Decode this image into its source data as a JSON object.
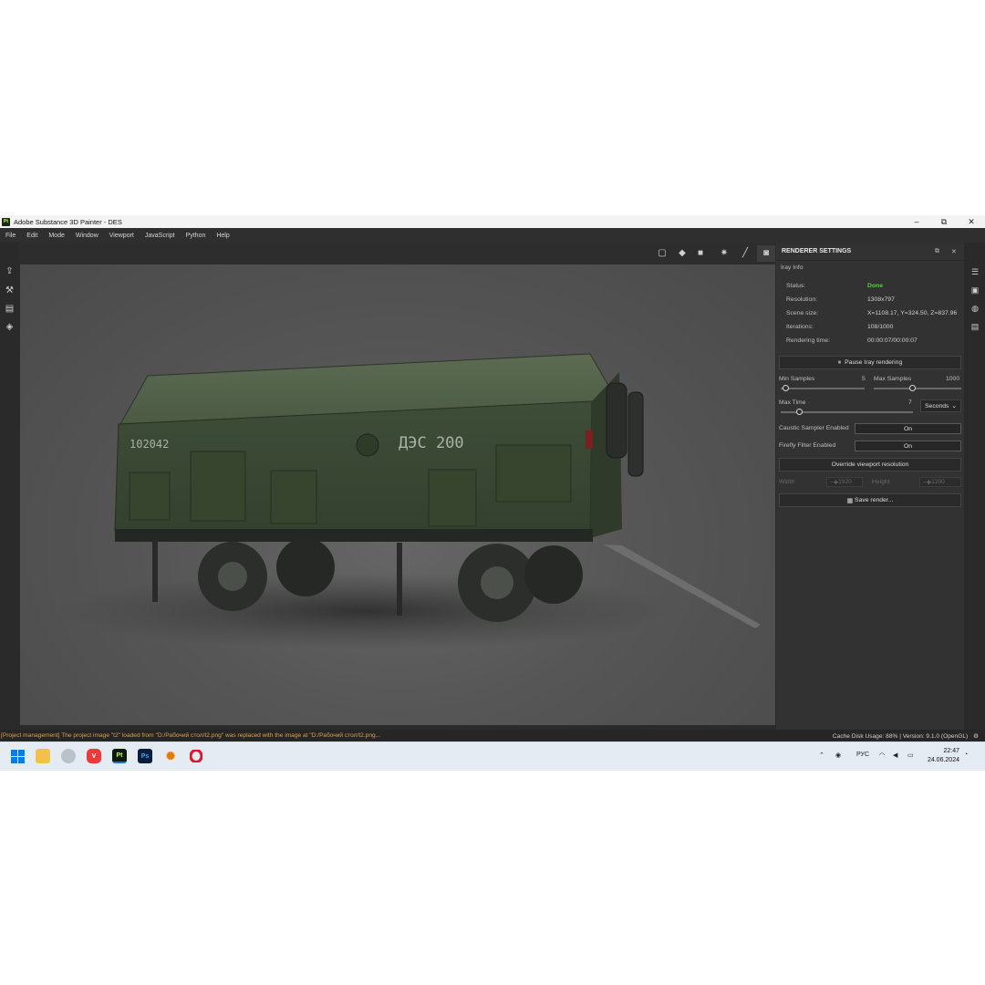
{
  "window": {
    "app_icon": "Pt",
    "title": "Adobe Substance 3D Painter - DES",
    "minimize": "–",
    "maximize": "⧉",
    "close": "✕"
  },
  "menu": [
    "File",
    "Edit",
    "Mode",
    "Window",
    "Viewport",
    "JavaScript",
    "Python",
    "Help"
  ],
  "viewport": {
    "trailer_number": "102042",
    "trailer_label": "ДЭС 200"
  },
  "panel": {
    "title": "RENDERER SETTINGS",
    "section": "Iray Info",
    "info": [
      {
        "label": "Status:",
        "value": "Done"
      },
      {
        "label": "Resolution:",
        "value": "1308x797"
      },
      {
        "label": "Scene size:",
        "value": "X=1108.17, Y=324.50, Z=837.96"
      },
      {
        "label": "Iterations:",
        "value": "108/1000"
      },
      {
        "label": "Rendering time:",
        "value": "00:00:07/00:00:07"
      }
    ],
    "status_color": "#4cd33a",
    "pause_button": "Pause Iray rendering",
    "min_samples_label": "Min Samples",
    "min_samples_value": "5",
    "max_samples_label": "Max Samples",
    "max_samples_value": "1000",
    "max_time_label": "Max Time",
    "max_time_value": "7",
    "time_unit": "Seconds",
    "caustic_label": "Caustic Sampler Enabled",
    "caustic_value": "On",
    "firefly_label": "Firefly Filter Enabled",
    "firefly_value": "On",
    "override_button": "Override viewport resolution",
    "width_label": "Width",
    "width_value": "1920",
    "height_label": "Height",
    "height_value": "1200",
    "save_button": "Save render..."
  },
  "status": {
    "message": "[Project management] The project image \"t2\" loaded from \"D:/Рабочий стол/t2.png\" was replaced with the image at \"D:/Рабочий стол/t2.png...",
    "cache": "Cache Disk Usage:   88% | Version: 9.1.0 (OpenGL)"
  },
  "taskbar": {
    "lang": "РУС",
    "time": "22:47",
    "date": "24.06.2024",
    "apps": [
      "windows-start",
      "file-explorer",
      "settings",
      "vivaldi",
      "substance-painter",
      "photoshop",
      "blender",
      "opera"
    ]
  },
  "icons": {
    "left": [
      "export-icon",
      "layers-brush-icon",
      "document-icon",
      "stack-icon"
    ],
    "right": [
      "layers-panel-icon",
      "texture-set-icon",
      "shader-icon",
      "properties-icon"
    ]
  }
}
